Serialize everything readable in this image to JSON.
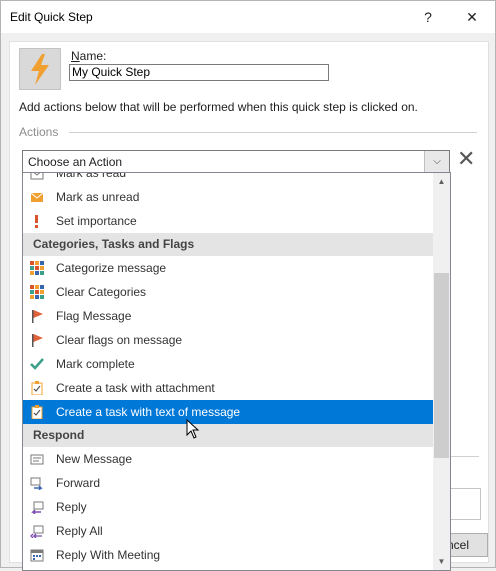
{
  "window": {
    "title": "Edit Quick Step",
    "help": "?",
    "close": "✕"
  },
  "name_field": {
    "label_hotkey": "N",
    "label_rest": "ame:",
    "value": "My Quick Step"
  },
  "description": "Add actions below that will be performed when this quick step is clicked on.",
  "actions_label": "Actions",
  "combo": {
    "text": "Choose an Action",
    "arrow": "⌵"
  },
  "delete_glyph": "✕",
  "partial_button": "ncel",
  "dropdown": {
    "items": [
      {
        "type": "item",
        "label": "Mark as read",
        "icon": "envelope-open-icon"
      },
      {
        "type": "item",
        "label": "Mark as unread",
        "icon": "envelope-closed-icon"
      },
      {
        "type": "item",
        "label": "Set importance",
        "icon": "exclamation-icon"
      },
      {
        "type": "header",
        "label": "Categories, Tasks and Flags"
      },
      {
        "type": "item",
        "label": "Categorize message",
        "icon": "category-grid-icon"
      },
      {
        "type": "item",
        "label": "Clear Categories",
        "icon": "category-grid-icon"
      },
      {
        "type": "item",
        "label": "Flag Message",
        "icon": "flag-icon"
      },
      {
        "type": "item",
        "label": "Clear flags on message",
        "icon": "flag-icon"
      },
      {
        "type": "item",
        "label": "Mark complete",
        "icon": "checkmark-icon"
      },
      {
        "type": "item",
        "label": "Create a task with attachment",
        "icon": "task-clipboard-icon"
      },
      {
        "type": "item",
        "label": "Create a task with text of message",
        "icon": "task-clipboard-icon",
        "selected": true
      },
      {
        "type": "header",
        "label": "Respond"
      },
      {
        "type": "item",
        "label": "New Message",
        "icon": "new-message-icon"
      },
      {
        "type": "item",
        "label": "Forward",
        "icon": "forward-icon"
      },
      {
        "type": "item",
        "label": "Reply",
        "icon": "reply-icon"
      },
      {
        "type": "item",
        "label": "Reply All",
        "icon": "reply-all-icon"
      },
      {
        "type": "item",
        "label": "Reply With Meeting",
        "icon": "calendar-icon"
      }
    ]
  },
  "colors": {
    "selection": "#0078d7",
    "header_bg": "#e4e4e4",
    "flag": "#e0623a",
    "check": "#3aa08a",
    "orange": "#f0a030"
  }
}
